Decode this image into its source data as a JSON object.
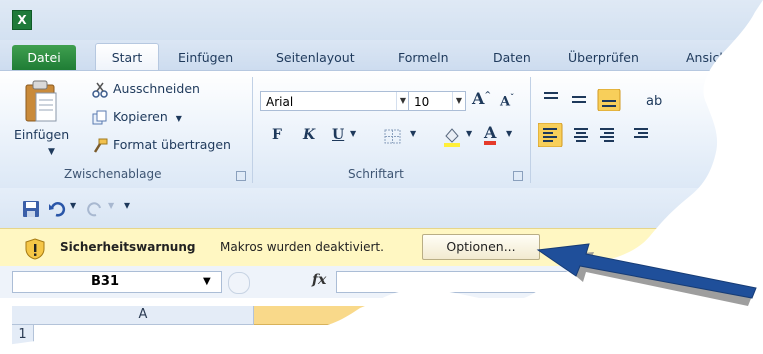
{
  "app": {
    "icon_letter": "X"
  },
  "tabs": [
    "Datei",
    "Start",
    "Einfügen",
    "Seitenlayout",
    "Formeln",
    "Daten",
    "Überprüfen",
    "Ansicht"
  ],
  "clipboard": {
    "paste_label": "Einfügen",
    "cut_label": "Ausschneiden",
    "copy_label": "Kopieren",
    "format_painter_label": "Format übertragen",
    "group_label": "Zwischenablage"
  },
  "font": {
    "font_name": "Arial",
    "font_size": "10",
    "bold_glyph": "F",
    "italic_glyph": "K",
    "underline_glyph": "U",
    "grow_glyph": "A",
    "shrink_glyph": "A",
    "color_glyph": "A",
    "group_label": "Schriftart"
  },
  "security_bar": {
    "title": "Sicherheitswarnung",
    "message": "Makros wurden deaktiviert.",
    "options_button": "Optionen..."
  },
  "formula_bar": {
    "name_box": "B31",
    "fx_label": "fx"
  },
  "sheet": {
    "column_a": "A",
    "row_1": "1"
  },
  "colors": {
    "file_tab": "#2a8a3f",
    "security_bar": "#fff7c2",
    "arrow": "#1f4f9a",
    "selected_column": "#f9d98a"
  }
}
